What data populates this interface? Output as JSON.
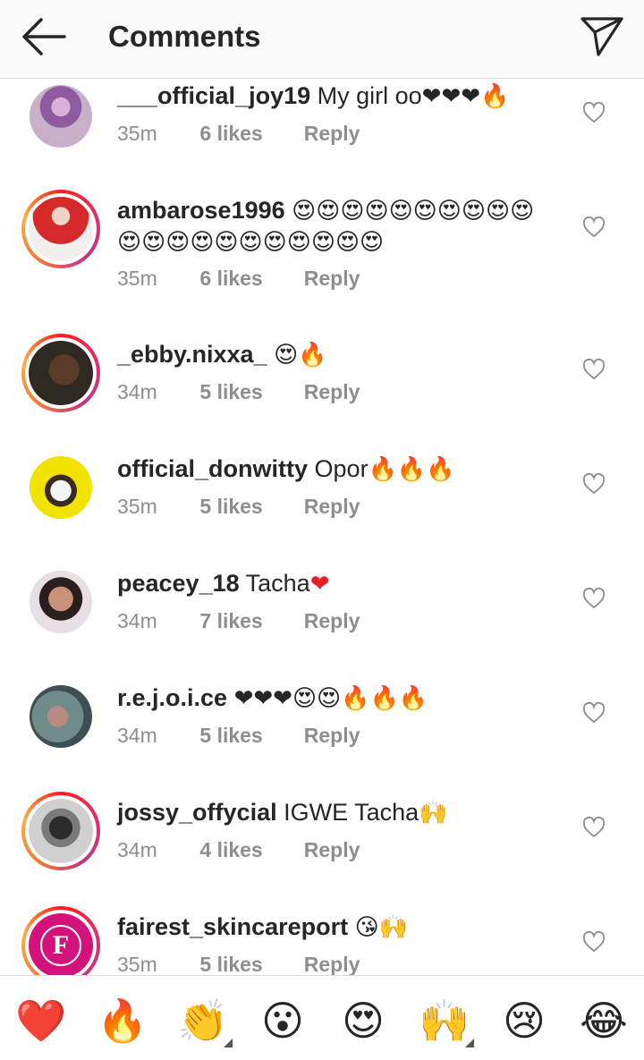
{
  "header": {
    "title": "Comments"
  },
  "comments": [
    {
      "user": "___official_joy19",
      "body": "My girl oo",
      "emoji": "❤❤❤🔥",
      "time": "35m",
      "likes": "6 likes",
      "reply": "Reply"
    },
    {
      "user": "ambarose1996",
      "body": "",
      "emoji": "😍😍😍😍😍😍😍😍😍😍😍😍😍😍😍😍😍😍😍😍😍",
      "time": "35m",
      "likes": "6 likes",
      "reply": "Reply"
    },
    {
      "user": "_ebby.nixxa_",
      "body": "",
      "emoji": "😍🔥",
      "time": "34m",
      "likes": "5 likes",
      "reply": "Reply"
    },
    {
      "user": "official_donwitty",
      "body": "Opor",
      "emoji": "🔥🔥🔥",
      "time": "35m",
      "likes": "5 likes",
      "reply": "Reply"
    },
    {
      "user": "peacey_18",
      "body": "Tacha",
      "emoji": "❤",
      "time": "34m",
      "likes": "7 likes",
      "reply": "Reply"
    },
    {
      "user": "r.e.j.o.i.ce",
      "body": "",
      "emoji": "❤❤❤😍😍🔥🔥🔥",
      "time": "34m",
      "likes": "5 likes",
      "reply": "Reply"
    },
    {
      "user": "jossy_offycial",
      "body": "IGWE Tacha",
      "emoji": "🙌",
      "time": "34m",
      "likes": "4 likes",
      "reply": "Reply"
    },
    {
      "user": "fairest_skincareport",
      "body": "",
      "emoji": "😘🙌",
      "time": "35m",
      "likes": "5 likes",
      "reply": "Reply"
    }
  ],
  "avatar_letter": "F",
  "quick_reactions": [
    "❤️",
    "🔥",
    "👏",
    "😮",
    "😍",
    "🙌",
    "😢",
    "😂"
  ],
  "colors": {
    "text": "#262626",
    "meta": "#8e8e8e",
    "heart": "#ed4956"
  }
}
